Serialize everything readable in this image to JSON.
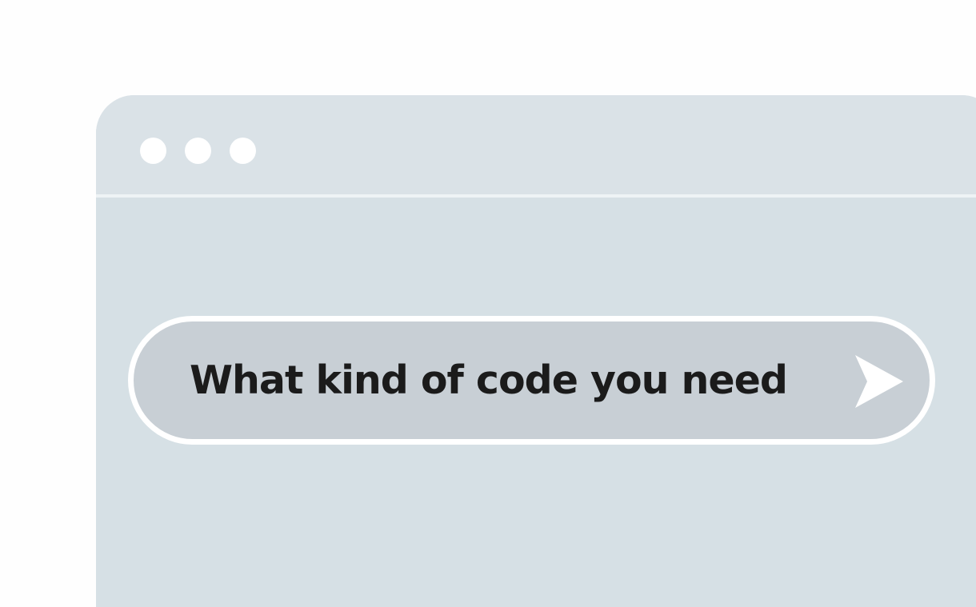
{
  "window": {
    "controls": [
      "dot",
      "dot",
      "dot"
    ]
  },
  "prompt": {
    "text": "What kind of code you need",
    "send_icon": "send-arrow-icon"
  },
  "colors": {
    "page_background": "#fefefe",
    "window_background": "#d6e0e5",
    "titlebar_background": "#dae2e7",
    "prompt_background": "#c8cfd5",
    "prompt_border": "#ffffff",
    "text": "#1b1b1b"
  }
}
